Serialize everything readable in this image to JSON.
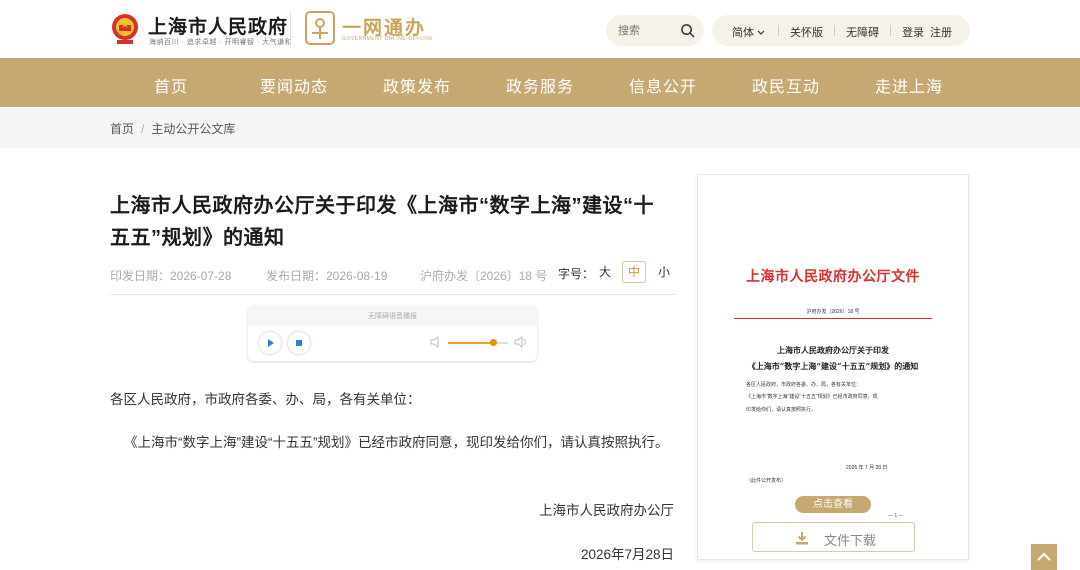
{
  "header": {
    "site_name": "上海市人民政府",
    "site_slogan": "海纳百川 · 追求卓越 · 开明睿智 · 大气谦和",
    "ywtb_name": "一网通办",
    "ywtb_sub": "GOVERNMENT ONLINE-OFFLINE",
    "search_placeholder": "搜索",
    "tools": {
      "lang": "简体",
      "care": "关怀版",
      "accessible": "无障碍",
      "login": "登录",
      "register": "注册"
    },
    "colors": {
      "brand_gold": "#c5a872",
      "gold_text": "#c9a45e",
      "doc_red": "#d9302b"
    }
  },
  "nav": {
    "items": [
      "首页",
      "要闻动态",
      "政策发布",
      "政务服务",
      "信息公开",
      "政民互动",
      "走进上海"
    ]
  },
  "breadcrumb": {
    "home": "首页",
    "current": "主动公开公文库"
  },
  "article": {
    "title": "上海市人民政府办公厅关于印发《上海市“数字上海”建设“十五五”规划》的通知",
    "issue_date": "印发日期：2026-07-28",
    "publish_date": "发布日期：2026-08-19",
    "doc_number": "沪府办发〔2026〕18 号",
    "font_size_label": "字号：",
    "font_size_options": [
      "大",
      "中",
      "小"
    ],
    "font_size_selected": "中",
    "audio_label": "无障碍语音播报",
    "audio_volume": 0.75,
    "salutation": "各区人民政府，市政府各委、办、局，各有关单位：",
    "body": "《上海市“数字上海”建设“十五五”规划》已经市政府同意，现印发给你们，请认真按照执行。",
    "signature": "上海市人民政府办公厅",
    "sign_date": "2026年7月28日"
  },
  "doc_preview": {
    "head": "上海市人民政府办公厅文件",
    "number": "沪府办发〔2026〕18 号",
    "title_line1": "上海市人民政府办公厅关于印发",
    "title_line2": "《上海市“数字上海”建设“十五五”规划》的通知",
    "line1": "各区人民政府，市政府各委、办、局，各有关单位：",
    "line2": "《上海市“数字上海”建设“十五五”规划》已经市政府同意，现",
    "line3": "印发给你们，请认真按照执行。",
    "date": "2026 年 7 月 28 日",
    "public_note": "（此件公开发布）",
    "view_label": "点击查看",
    "page_indicator": "— 1 —",
    "download_label": "文件下载"
  }
}
